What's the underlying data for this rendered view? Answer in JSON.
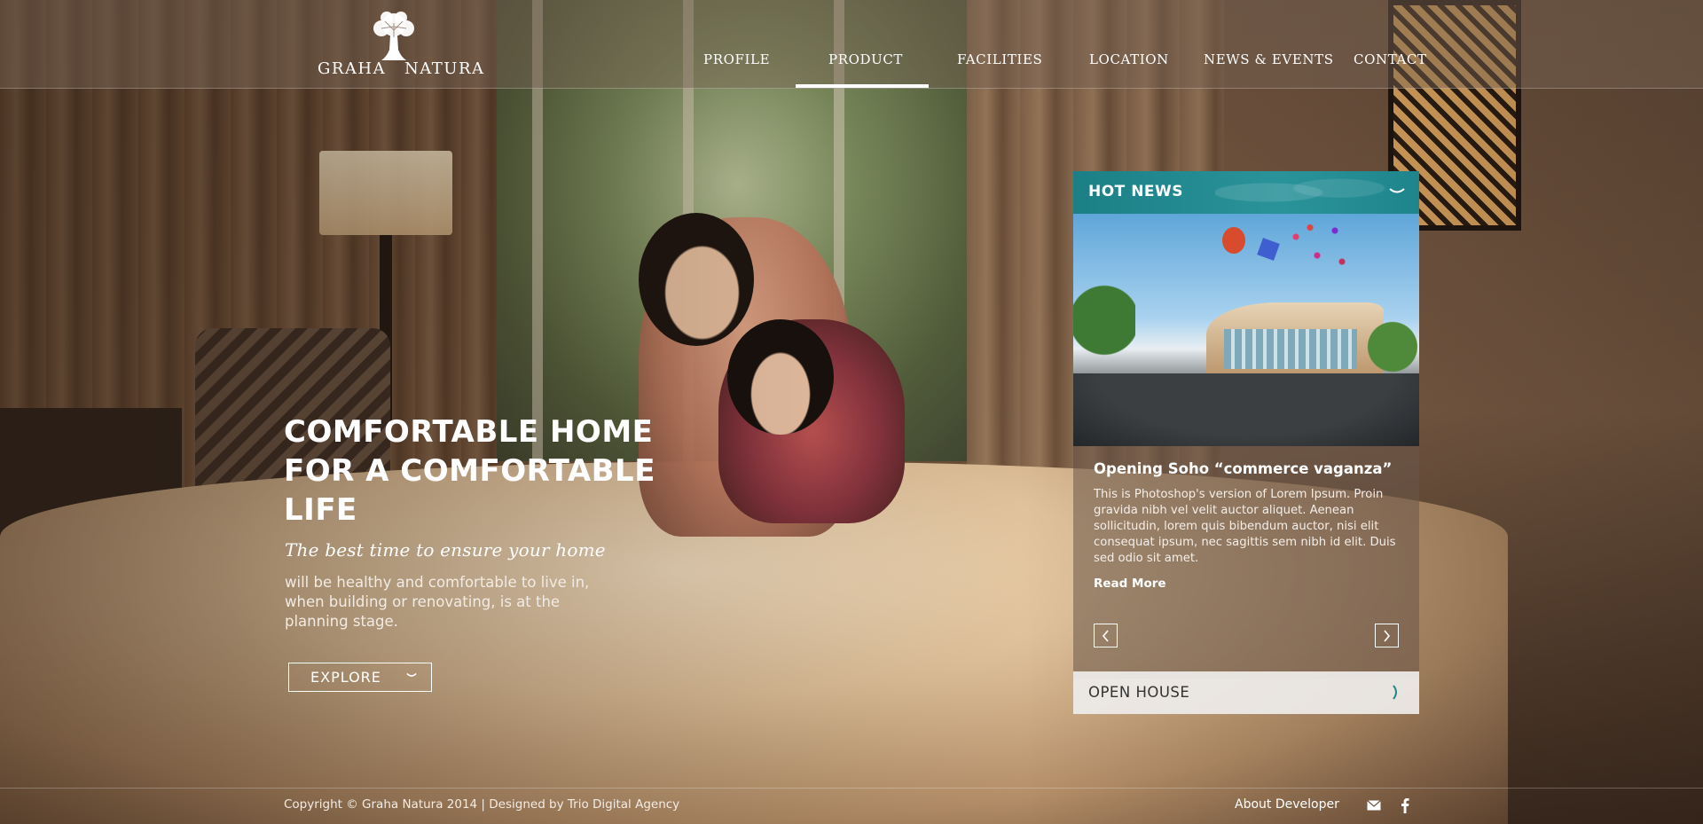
{
  "brand": {
    "logo_left": "GRAHA",
    "logo_right": "NATURA",
    "icon": "tree-logo-icon"
  },
  "nav": {
    "items": [
      {
        "label": "PROFILE",
        "active": false
      },
      {
        "label": "PRODUCT",
        "active": true
      },
      {
        "label": "FACILITIES",
        "active": false
      },
      {
        "label": "LOCATION",
        "active": false
      },
      {
        "label": "NEWS & EVENTS",
        "active": false
      },
      {
        "label": "CONTACT",
        "active": false
      }
    ]
  },
  "hero": {
    "title_lines": [
      "COMFORTABLE HOME",
      "FOR A COMFORTABLE",
      "LIFE"
    ],
    "subtitle": "The best time to ensure your home",
    "body": "will be healthy and comfortable to live in, when building or renovating, is at the planning stage.",
    "explore_label": "EXPLORE",
    "explore_icon": "chevron-down-icon"
  },
  "news": {
    "header": "HOT NEWS",
    "toggle_icon": "chevron-down-icon",
    "headline": "Opening Soho “commerce vaganza”",
    "text": "This is Photoshop's version  of Lorem Ipsum. Proin gravida nibh vel velit auctor aliquet. Aenean sollicitudin, lorem quis bibendum auctor, nisi elit consequat ipsum, nec sagittis sem nibh id elit. Duis sed odio sit amet.",
    "read_more": "Read More",
    "prev_icon": "chevron-left-icon",
    "next_icon": "chevron-right-icon",
    "open_house": "OPEN HOUSE",
    "open_house_icon": "chevron-right-icon",
    "accent_color": "#1f868d"
  },
  "footer": {
    "copyright": "Copyright © Graha Natura 2014 | Designed by Trio Digital Agency",
    "about": "About Developer",
    "mail_icon": "mail-icon",
    "facebook_icon": "facebook-icon"
  }
}
